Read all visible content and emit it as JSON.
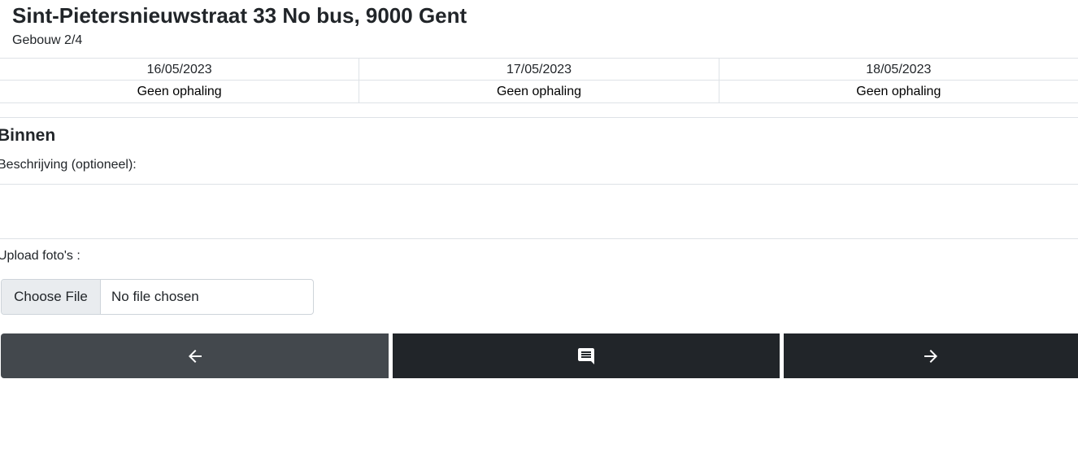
{
  "header": {
    "address": "Sint-Pietersnieuwstraat 33 No bus, 9000 Gent",
    "building": "Gebouw 2/4"
  },
  "schedule": [
    {
      "date": "16/05/2023",
      "status": "Geen ophaling"
    },
    {
      "date": "17/05/2023",
      "status": "Geen ophaling"
    },
    {
      "date": "18/05/2023",
      "status": "Geen ophaling"
    }
  ],
  "section": {
    "title": "Binnen",
    "description_label": "Beschrijving (optioneel):",
    "description_value": "",
    "upload_label": "Upload foto's :"
  },
  "file_input": {
    "button_label": "Choose File",
    "status": "No file chosen"
  },
  "nav": {
    "prev_icon": "arrow-left-icon",
    "comment_icon": "comment-icon",
    "next_icon": "arrow-right-icon"
  },
  "colors": {
    "prev_button": "#43484d",
    "dark_button": "#212529",
    "border": "#dee2e6"
  }
}
